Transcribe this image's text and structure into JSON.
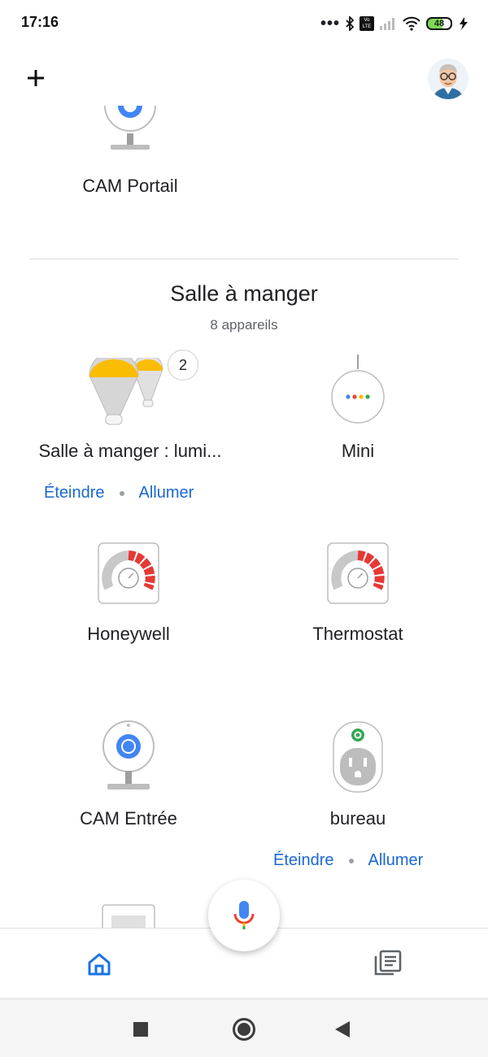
{
  "status_bar": {
    "time": "17:16",
    "battery": "48",
    "volte": "Vo LTE"
  },
  "header": {
    "add_label": "+"
  },
  "devices_top": {
    "cam_portail": "CAM Portail"
  },
  "room": {
    "title": "Salle à manger",
    "count": "8 appareils",
    "devices": {
      "lights": {
        "label": "Salle à manger : lumi...",
        "badge": "2",
        "off": "Éteindre",
        "on": "Allumer"
      },
      "mini": {
        "label": "Mini"
      },
      "honeywell": {
        "label": "Honeywell"
      },
      "thermostat": {
        "label": "Thermostat"
      },
      "cam_entree": {
        "label": "CAM Entrée"
      },
      "bureau": {
        "label": "bureau",
        "off": "Éteindre",
        "on": "Allumer"
      }
    }
  },
  "bottom_nav": {
    "home": "home-icon",
    "feed": "feed-icon"
  },
  "colors": {
    "accent": "#1a73e8",
    "bulb_yellow": "#fbbc04",
    "red": "#e53935",
    "green": "#34a853"
  }
}
